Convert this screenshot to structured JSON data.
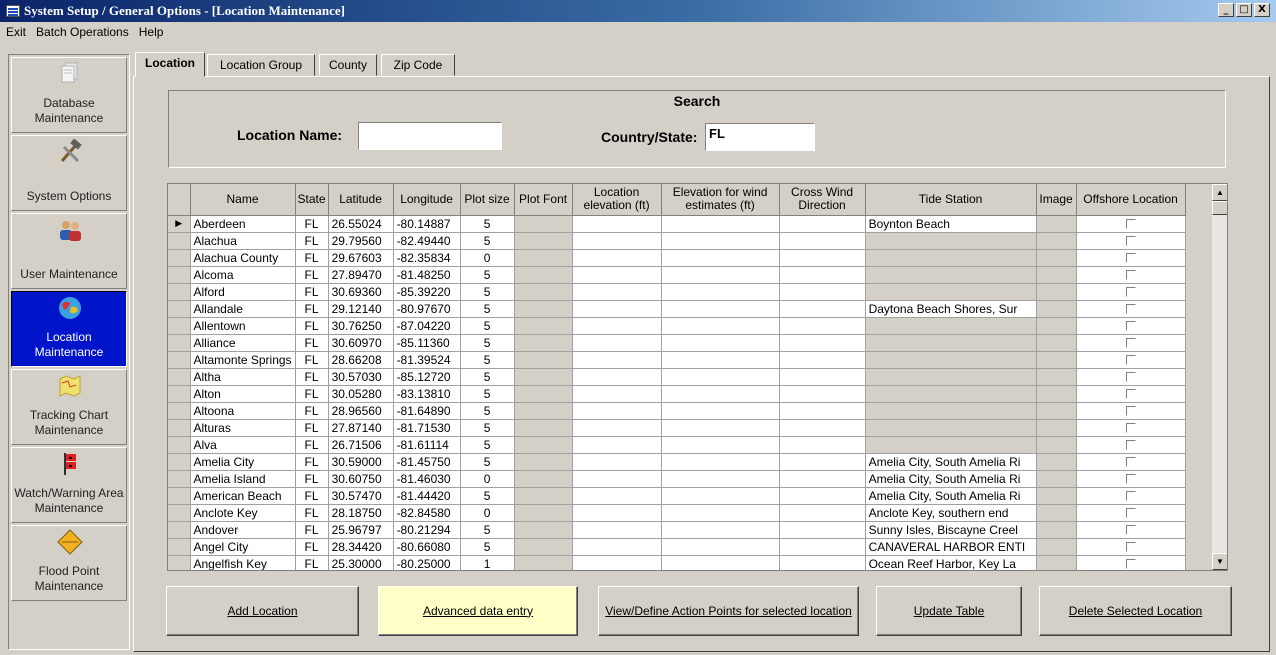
{
  "window": {
    "title": "System Setup / General Options - [Location Maintenance]",
    "minimize": "_",
    "maximize": "□",
    "close": "X"
  },
  "menu": [
    "Exit",
    "Batch Operations",
    "Help"
  ],
  "sidebar": {
    "items": [
      {
        "label": "Database Maintenance",
        "icon": "document-icon"
      },
      {
        "label": "System Options",
        "icon": "tools-icon"
      },
      {
        "label": "User Maintenance",
        "icon": "users-icon"
      },
      {
        "label": "Location Maintenance",
        "icon": "globe-icon",
        "active": true
      },
      {
        "label": "Tracking Chart Maintenance",
        "icon": "map-icon"
      },
      {
        "label": "Watch/Warning Area Maintenance",
        "icon": "warning-flag-icon"
      },
      {
        "label": "Flood Point Maintenance",
        "icon": "diamond-sign-icon"
      }
    ]
  },
  "tabs": [
    "Location",
    "Location Group",
    "County",
    "Zip Code"
  ],
  "search": {
    "title": "Search",
    "location_name_label": "Location Name:",
    "location_name_value": "",
    "country_state_label": "Country/State:",
    "country_state_value": "FL"
  },
  "grid": {
    "columns": [
      "Name",
      "State",
      "Latitude",
      "Longitude",
      "Plot size",
      "Plot Font",
      "Location elevation (ft)",
      "Elevation for wind estimates (ft)",
      "Cross Wind Direction",
      "Tide Station",
      "Image",
      "Offshore Location"
    ],
    "current_row_marker": "▶",
    "rows": [
      {
        "name": "Aberdeen",
        "state": "FL",
        "lat": "26.55024",
        "lon": "-80.14887",
        "plot": "5",
        "tide": "Boynton Beach"
      },
      {
        "name": "Alachua",
        "state": "FL",
        "lat": "29.79560",
        "lon": "-82.49440",
        "plot": "5",
        "tide": ""
      },
      {
        "name": "Alachua County",
        "state": "FL",
        "lat": "29.67603",
        "lon": "-82.35834",
        "plot": "0",
        "tide": ""
      },
      {
        "name": "Alcoma",
        "state": "FL",
        "lat": "27.89470",
        "lon": "-81.48250",
        "plot": "5",
        "tide": ""
      },
      {
        "name": "Alford",
        "state": "FL",
        "lat": "30.69360",
        "lon": "-85.39220",
        "plot": "5",
        "tide": ""
      },
      {
        "name": "Allandale",
        "state": "FL",
        "lat": "29.12140",
        "lon": "-80.97670",
        "plot": "5",
        "tide": "Daytona Beach Shores, Sur"
      },
      {
        "name": "Allentown",
        "state": "FL",
        "lat": "30.76250",
        "lon": "-87.04220",
        "plot": "5",
        "tide": ""
      },
      {
        "name": "Alliance",
        "state": "FL",
        "lat": "30.60970",
        "lon": "-85.11360",
        "plot": "5",
        "tide": ""
      },
      {
        "name": "Altamonte Springs",
        "state": "FL",
        "lat": "28.66208",
        "lon": "-81.39524",
        "plot": "5",
        "tide": ""
      },
      {
        "name": "Altha",
        "state": "FL",
        "lat": "30.57030",
        "lon": "-85.12720",
        "plot": "5",
        "tide": ""
      },
      {
        "name": "Alton",
        "state": "FL",
        "lat": "30.05280",
        "lon": "-83.13810",
        "plot": "5",
        "tide": ""
      },
      {
        "name": "Altoona",
        "state": "FL",
        "lat": "28.96560",
        "lon": "-81.64890",
        "plot": "5",
        "tide": ""
      },
      {
        "name": "Alturas",
        "state": "FL",
        "lat": "27.87140",
        "lon": "-81.71530",
        "plot": "5",
        "tide": ""
      },
      {
        "name": "Alva",
        "state": "FL",
        "lat": "26.71506",
        "lon": "-81.61114",
        "plot": "5",
        "tide": ""
      },
      {
        "name": "Amelia City",
        "state": "FL",
        "lat": "30.59000",
        "lon": "-81.45750",
        "plot": "5",
        "tide": "Amelia City, South Amelia Ri"
      },
      {
        "name": "Amelia Island",
        "state": "FL",
        "lat": "30.60750",
        "lon": "-81.46030",
        "plot": "0",
        "tide": "Amelia City, South Amelia Ri"
      },
      {
        "name": "American Beach",
        "state": "FL",
        "lat": "30.57470",
        "lon": "-81.44420",
        "plot": "5",
        "tide": "Amelia City, South Amelia Ri"
      },
      {
        "name": "Anclote Key",
        "state": "FL",
        "lat": "28.18750",
        "lon": "-82.84580",
        "plot": "0",
        "tide": "Anclote Key, southern end"
      },
      {
        "name": "Andover",
        "state": "FL",
        "lat": "25.96797",
        "lon": "-80.21294",
        "plot": "5",
        "tide": "Sunny Isles, Biscayne Creel"
      },
      {
        "name": "Angel City",
        "state": "FL",
        "lat": "28.34420",
        "lon": "-80.66080",
        "plot": "5",
        "tide": "CANAVERAL HARBOR ENTI"
      },
      {
        "name": "Angelfish Key",
        "state": "FL",
        "lat": "25.30000",
        "lon": "-80.25000",
        "plot": "1",
        "tide": "Ocean Reef Harbor, Key La"
      }
    ]
  },
  "buttons": {
    "add": "Add Location",
    "advanced": "Advanced data entry",
    "view_define": "View/Define Action Points for selected location",
    "update": "Update Table",
    "delete": "Delete Selected Location"
  },
  "colors": {
    "title_gradient_start": "#0a246a",
    "active_sidebar": "#0014c9",
    "highlight_button": "#ffffc8"
  }
}
